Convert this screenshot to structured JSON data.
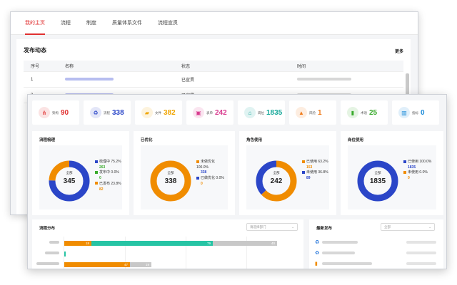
{
  "back": {
    "tabs": [
      "我的主页",
      "流程",
      "制度",
      "质量体系文件",
      "流程宣贯"
    ],
    "active_tab": 0,
    "section_title": "发布动态",
    "more": "更多",
    "headers": [
      "序号",
      "名称",
      "状态",
      "时间"
    ],
    "rows": [
      {
        "idx": "1",
        "status": "已宣贯"
      },
      {
        "idx": "2",
        "status": "已宣贯"
      }
    ]
  },
  "cards": [
    {
      "label": "架构",
      "value": "90",
      "color": "#e03030",
      "icon": "hierarchy-icon"
    },
    {
      "label": "流程",
      "value": "338",
      "color": "#2b46c8",
      "icon": "recycle-icon"
    },
    {
      "label": "文件",
      "value": "382",
      "color": "#f0a500",
      "icon": "folder-icon"
    },
    {
      "label": "表单",
      "value": "242",
      "color": "#d83a8e",
      "icon": "form-icon"
    },
    {
      "label": "岗位",
      "value": "1835",
      "color": "#17a89a",
      "icon": "building-icon"
    },
    {
      "label": "风险",
      "value": "1",
      "color": "#f07b1a",
      "icon": "warning-icon"
    },
    {
      "label": "术语",
      "value": "25",
      "color": "#3aab2c",
      "icon": "book-icon"
    },
    {
      "label": "指标",
      "value": "0",
      "color": "#1a8ad8",
      "icon": "bar-chart-icon"
    }
  ],
  "donuts": [
    {
      "title": "流程梳理",
      "center_label": "全部",
      "total": "345",
      "colors": [
        "#2b46c8",
        "#3aab2c",
        "#f08c00"
      ],
      "values": [
        260,
        0,
        85
      ],
      "legend": [
        {
          "name": "梳理中",
          "pct": "75.2%",
          "count": "263",
          "color": "#2b46c8",
          "count_color": "#3aab2c"
        },
        {
          "name": "发布中",
          "pct": "0.0%",
          "count": "0",
          "color": "#3aab2c",
          "count_color": "#3aab2c"
        },
        {
          "name": "已发布",
          "pct": "23.8%",
          "count": "82",
          "color": "#f08c00",
          "count_color": "#f08c00"
        }
      ]
    },
    {
      "title": "已优化",
      "center_label": "全部",
      "total": "338",
      "colors": [
        "#f08c00",
        "#2b46c8"
      ],
      "values": [
        338,
        0
      ],
      "legend": [
        {
          "name": "未做优化",
          "pct": "100.0%",
          "count": "338",
          "color": "#f08c00",
          "count_color": "#2b46c8"
        },
        {
          "name": "已做优化",
          "pct": "0.0%",
          "count": "0",
          "color": "#2b46c8",
          "count_color": "#f08c00"
        }
      ]
    },
    {
      "title": "角色使用",
      "center_label": "全部",
      "total": "242",
      "colors": [
        "#f08c00",
        "#2b46c8"
      ],
      "values": [
        153,
        89
      ],
      "legend": [
        {
          "name": "已使用",
          "pct": "63.2%",
          "count": "153",
          "color": "#f08c00",
          "count_color": "#f08c00"
        },
        {
          "name": "未使用",
          "pct": "36.8%",
          "count": "89",
          "color": "#2b46c8",
          "count_color": "#2b46c8"
        }
      ]
    },
    {
      "title": "岗位使用",
      "center_label": "全部",
      "total": "1835",
      "colors": [
        "#2b46c8",
        "#f08c00"
      ],
      "values": [
        1835,
        0
      ],
      "legend": [
        {
          "name": "已使用",
          "pct": "100.0%",
          "count": "1835",
          "color": "#2b46c8",
          "count_color": "#2b46c8"
        },
        {
          "name": "未使用",
          "pct": "0.0%",
          "count": "0",
          "color": "#f08c00",
          "count_color": "#f08c00"
        }
      ]
    }
  ],
  "flow": {
    "title": "流程分布",
    "select": "请选择部门",
    "bars": [
      {
        "a": "18",
        "b": "79",
        "c": "40"
      },
      {
        "a": "",
        "b": "",
        "c": ""
      },
      {
        "a": "47",
        "b": "",
        "c": "19"
      }
    ]
  },
  "latest": {
    "title": "最新发布",
    "select": "全部",
    "items": [
      {
        "icon": "recycle-icon"
      },
      {
        "icon": "recycle-icon"
      },
      {
        "icon": "file-icon"
      }
    ]
  }
}
